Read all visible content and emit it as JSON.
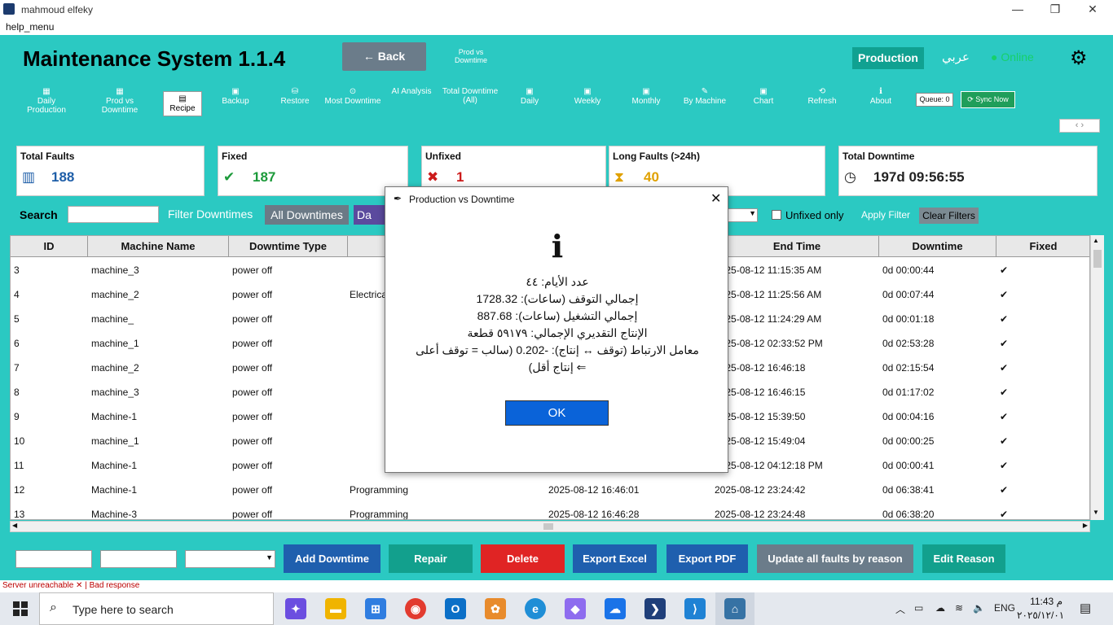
{
  "window": {
    "title": "mahmoud elfeky",
    "minimize": "—",
    "restore": "❐",
    "close": "✕"
  },
  "menu": {
    "help": "help_menu"
  },
  "header": {
    "title": "Maintenance System 1.1.4",
    "back": "← Back",
    "prod_vs_downtime": "Prod vs Downtime",
    "production": "Production",
    "arabic": "عربي",
    "online": "● Online",
    "gear_icon": "gear-icon"
  },
  "toolbar": [
    {
      "label": "Daily Production",
      "icon": "▦"
    },
    {
      "label": "Prod vs Downtime",
      "icon": "▦"
    },
    {
      "label": "Recipe",
      "icon": "▤"
    },
    {
      "label": "Backup",
      "icon": "▣"
    },
    {
      "label": "Restore",
      "icon": "⛁"
    },
    {
      "label": "Most Downtime",
      "icon": "⊙"
    },
    {
      "label": "AI Analysis",
      "icon": ""
    },
    {
      "label": "Total Downtime (All)",
      "icon": ""
    },
    {
      "label": "Daily",
      "icon": "▣"
    },
    {
      "label": "Weekly",
      "icon": "▣"
    },
    {
      "label": "Monthly",
      "icon": "▣"
    },
    {
      "label": "By Machine",
      "icon": "✎"
    },
    {
      "label": "Chart",
      "icon": "▣"
    },
    {
      "label": "Refresh",
      "icon": "⟲"
    },
    {
      "label": "About",
      "icon": "ℹ"
    }
  ],
  "queue": "Queue: 0",
  "sync": "⟳ Sync Now",
  "nav": "‹  ›",
  "cards": [
    {
      "label": "Total Faults",
      "value": "188",
      "icon": "▥",
      "color": "#1e5ea8"
    },
    {
      "label": "Fixed",
      "value": "187",
      "icon": "✔",
      "color": "#1c9a3a"
    },
    {
      "label": "Unfixed",
      "value": "1",
      "icon": "✖",
      "color": "#cc1b1b"
    },
    {
      "label": "Long Faults (>24h)",
      "value": "40",
      "icon": "⧗",
      "color": "#e0a100"
    },
    {
      "label": "Total Downtime",
      "value": "197d 09:56:55",
      "icon": "◷",
      "color": "#222"
    }
  ],
  "filters": {
    "search": "Search",
    "filter_label": "Filter Downtimes",
    "all": "All Downtimes",
    "date": "Da",
    "unfixed_only": "Unfixed only",
    "apply": "Apply Filter",
    "clear": "Clear Filters"
  },
  "table": {
    "headers": [
      "ID",
      "Machine Name",
      "Downtime Type",
      "",
      "",
      "End Time",
      "Downtime",
      "Fixed"
    ],
    "rows": [
      [
        "3",
        "machine_3",
        "power off",
        "",
        "",
        "2025-08-12 11:15:35 AM",
        "0d 00:00:44",
        "✔"
      ],
      [
        "4",
        "machine_2",
        "power off",
        "Electrica",
        "",
        "2025-08-12 11:25:56 AM",
        "0d 00:07:44",
        "✔"
      ],
      [
        "5",
        "machine_",
        "power off",
        "",
        "",
        "2025-08-12 11:24:29 AM",
        "0d 00:01:18",
        "✔"
      ],
      [
        "6",
        "machine_1",
        "power off",
        "",
        "",
        "2025-08-12 02:33:52 PM",
        "0d 02:53:28",
        "✔"
      ],
      [
        "7",
        "machine_2",
        "power off",
        "",
        "",
        "2025-08-12 16:46:18",
        "0d 02:15:54",
        "✔"
      ],
      [
        "8",
        "machine_3",
        "power off",
        "",
        "",
        "2025-08-12 16:46:15",
        "0d 01:17:02",
        "✔"
      ],
      [
        "9",
        "Machine-1",
        "power off",
        "",
        "",
        "2025-08-12 15:39:50",
        "0d 00:04:16",
        "✔"
      ],
      [
        "10",
        "machine_1",
        "power off",
        "",
        "",
        "2025-08-12 15:49:04",
        "0d 00:00:25",
        "✔"
      ],
      [
        "11",
        "Machine-1",
        "power off",
        "",
        "",
        "2025-08-12 04:12:18 PM",
        "0d 00:00:41",
        "✔"
      ],
      [
        "12",
        "Machine-1",
        "power off",
        "Programming",
        "2025-08-12 16:46:01",
        "2025-08-12 23:24:42",
        "0d 06:38:41",
        "✔"
      ],
      [
        "13",
        "Machine-3",
        "power off",
        "Programming",
        "2025-08-12 16:46:28",
        "2025-08-12 23:24:48",
        "0d 06:38:20",
        "✔"
      ]
    ]
  },
  "actions": [
    {
      "label": "Add Downtime",
      "color": "#1f5fae"
    },
    {
      "label": "Repair",
      "color": "#12a08d"
    },
    {
      "label": "Delete",
      "color": "#e02424"
    },
    {
      "label": "Export Excel",
      "color": "#1f5fae"
    },
    {
      "label": "Export PDF",
      "color": "#1f5fae"
    },
    {
      "label": "Update all faults by reason",
      "color": "#6b7c8a"
    },
    {
      "label": "Edit Reason",
      "color": "#12a08d"
    }
  ],
  "status": "Server unreachable ✕ | Bad response",
  "dialog": {
    "title": "Production vs Downtime",
    "icon": "i",
    "lines": [
      "عدد الأيام: ٤٤",
      "إجمالي التوقف (ساعات): 1728.32",
      "إجمالي التشغيل (ساعات): 887.68",
      "الإنتاج التقديري الإجمالي: ٥٩١٧٩ قطعة",
      "معامل الارتباط (توقف ↔ إنتاج): -0.202 (سالب = توقف أعلى",
      "⇐ إنتاج أقل)"
    ],
    "ok": "OK"
  },
  "taskbar": {
    "search": "Type here to search",
    "lang": "ENG",
    "time": "11:43 م",
    "date": "٢٠٢٥/١٢/٠١"
  }
}
